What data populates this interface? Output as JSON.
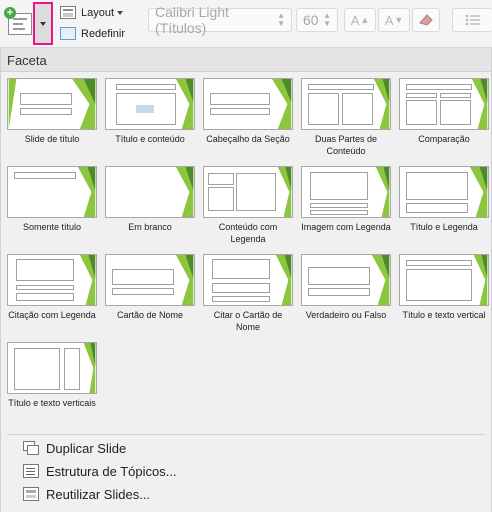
{
  "ribbon": {
    "layout_label": "Layout",
    "reset_label": "Redefinir",
    "font_name": "Calibri Light (Títulos)",
    "font_size": "60",
    "grow_font": "A",
    "shrink_font": "A"
  },
  "gallery": {
    "theme_name": "Faceta",
    "layouts": [
      {
        "name": "Slide de título"
      },
      {
        "name": "Título e conteúdo"
      },
      {
        "name": "Cabeçalho da Seção"
      },
      {
        "name": "Duas Partes de Conteúdo"
      },
      {
        "name": "Comparação"
      },
      {
        "name": "Somente título"
      },
      {
        "name": "Em branco"
      },
      {
        "name": "Conteúdo com Legenda"
      },
      {
        "name": "Imagem com Legenda"
      },
      {
        "name": "Título e Legenda"
      },
      {
        "name": "Citação com Legenda"
      },
      {
        "name": "Cartão de Nome"
      },
      {
        "name": "Citar o Cartão de Nome"
      },
      {
        "name": "Verdadeiro ou Falso"
      },
      {
        "name": "Título e texto vertical"
      },
      {
        "name": "Título e texto verticais"
      }
    ]
  },
  "menu": {
    "duplicate": "Duplicar Slide",
    "outline": "Estrutura de Tópicos...",
    "reuse": "Reutilizar Slides..."
  },
  "colors": {
    "accent_green": "#8cc63f",
    "dark_green": "#4e8a2a",
    "highlight_pink": "#e8168a"
  }
}
